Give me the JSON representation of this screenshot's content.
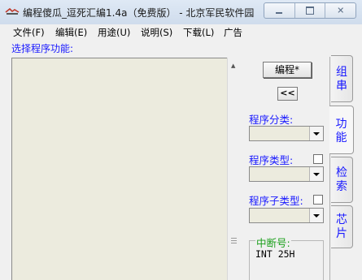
{
  "window": {
    "title": "编程傻瓜_逗死汇编1.4a（免费版） - 北京军民软件园",
    "icon": "app-icon"
  },
  "menu": [
    {
      "label": "文件(F)"
    },
    {
      "label": "编辑(E)"
    },
    {
      "label": "用途(U)"
    },
    {
      "label": "说明(S)"
    },
    {
      "label": "下载(L)"
    },
    {
      "label": "广告"
    }
  ],
  "main": {
    "section_label": "选择程序功能:",
    "content": ""
  },
  "panel": {
    "compile_button": "编程*",
    "collapse_button": "<<",
    "category_label": "程序分类:",
    "category_value": "",
    "type_label": "程序类型:",
    "type_value": "",
    "subtype_label": "程序子类型:",
    "subtype_value": "",
    "interrupt_label": "中断号:",
    "interrupt_value": "INT 25H"
  },
  "tabs": [
    {
      "label": "组\n串",
      "active": false
    },
    {
      "label": "功\n能",
      "active": true
    },
    {
      "label": "检\n索",
      "active": false
    },
    {
      "label": "芯\n片",
      "active": false
    }
  ],
  "colors": {
    "label_blue": "#1a1aff",
    "label_green": "#1a9f1a",
    "panel_bg": "#ecebde"
  }
}
